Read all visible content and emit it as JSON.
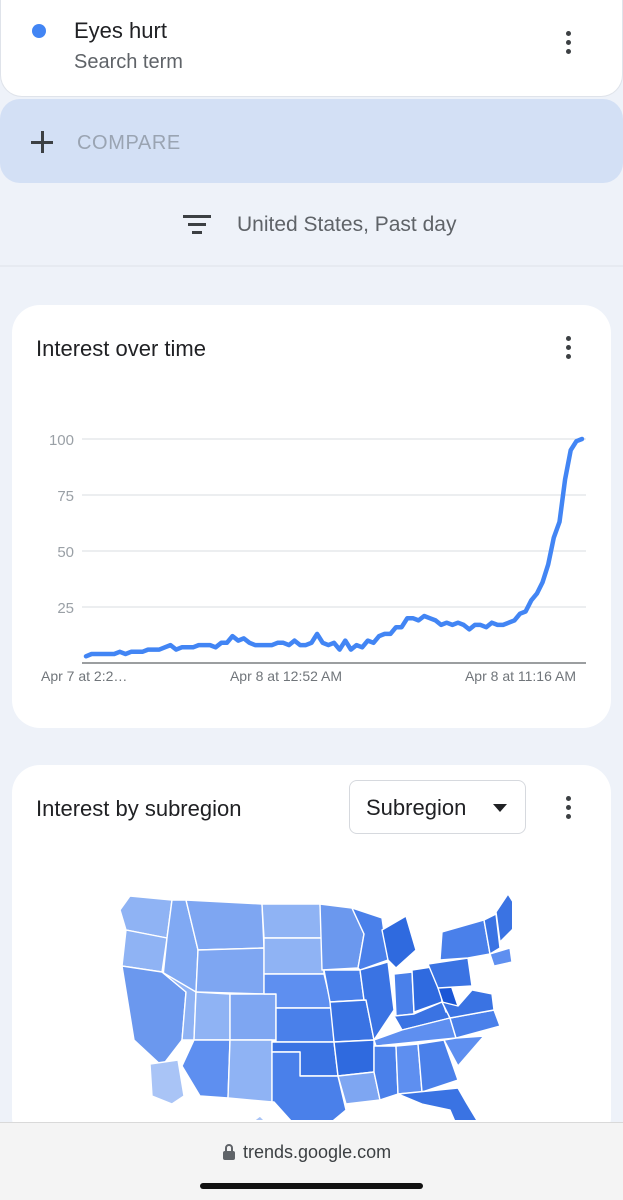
{
  "search_term": {
    "title": "Eyes hurt",
    "subtitle": "Search term",
    "color": "#4285f4",
    "menu_icon": "more-vert-icon"
  },
  "compare": {
    "label": "COMPARE",
    "icon": "plus-icon"
  },
  "filter": {
    "label": "United States, Past day",
    "icon": "filter-list-icon"
  },
  "interest_over_time": {
    "title": "Interest over time",
    "menu_icon": "more-vert-icon"
  },
  "chart_data": {
    "type": "line",
    "title": "Interest over time",
    "xlabel": "",
    "ylabel": "",
    "ylim": [
      0,
      100
    ],
    "yticks": [
      25,
      50,
      75,
      100
    ],
    "grid": true,
    "x_tick_labels": [
      "Apr 7 at 2:2…",
      "Apr 8 at 12:52 AM",
      "Apr 8 at 11:16 AM"
    ],
    "series": [
      {
        "color": "#4285f4",
        "values": [
          3,
          4,
          4,
          4,
          4,
          4,
          5,
          4,
          5,
          5,
          5,
          6,
          6,
          6,
          7,
          8,
          6,
          7,
          7,
          7,
          8,
          8,
          8,
          7,
          9,
          9,
          12,
          10,
          11,
          9,
          8,
          8,
          8,
          8,
          9,
          9,
          8,
          10,
          8,
          8,
          9,
          13,
          9,
          8,
          9,
          6,
          10,
          6,
          8,
          7,
          10,
          9,
          12,
          13,
          13,
          16,
          16,
          20,
          20,
          19,
          21,
          20,
          19,
          17,
          18,
          17,
          18,
          17,
          15,
          17,
          17,
          16,
          18,
          17,
          17,
          18,
          19,
          22,
          23,
          28,
          31,
          36,
          44,
          56,
          63,
          82,
          95,
          99,
          100
        ]
      }
    ]
  },
  "interest_by_subregion": {
    "title": "Interest by subregion",
    "dropdown_value": "Subregion",
    "menu_icon": "more-vert-icon",
    "map_icon": "us-states-choropleth-map"
  },
  "browser": {
    "url": "trends.google.com",
    "lock_icon": "lock-icon"
  }
}
